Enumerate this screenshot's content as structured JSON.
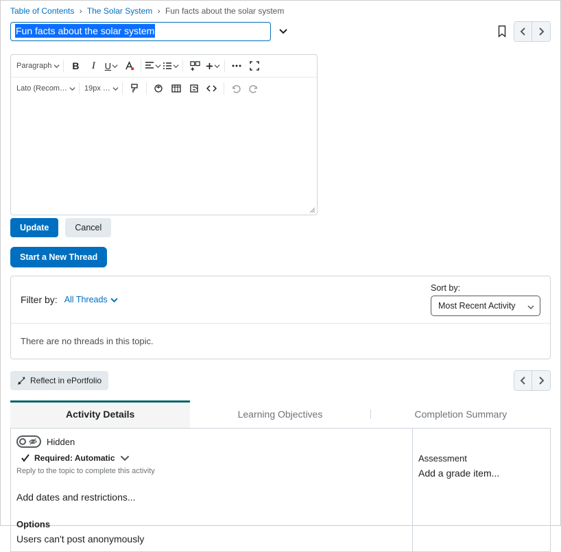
{
  "breadcrumb": {
    "root": "Table of Contents",
    "parent": "The Solar System",
    "current": "Fun facts about the solar system"
  },
  "title_value": "Fun facts about the solar system",
  "editor_toolbar": {
    "paragraph": "Paragraph",
    "font": "Lato (Recom…",
    "size": "19px …"
  },
  "buttons": {
    "update": "Update",
    "cancel": "Cancel",
    "new_thread": "Start a New Thread",
    "reflect": "Reflect in ePortfolio"
  },
  "threads": {
    "filter_label": "Filter by:",
    "filter_value": "All Threads",
    "sort_label": "Sort by:",
    "sort_value": "Most Recent Activity",
    "empty": "There are no threads in this topic."
  },
  "tabs": {
    "activity": "Activity Details",
    "objectives": "Learning Objectives",
    "completion": "Completion Summary"
  },
  "details": {
    "hidden": "Hidden",
    "required": "Required: Automatic",
    "hint": "Reply to the topic to complete this activity",
    "dates": "Add dates and restrictions...",
    "options_hdr": "Options",
    "options_text": "Users can't post anonymously"
  },
  "assessment": {
    "hdr": "Assessment",
    "link": "Add a grade item..."
  }
}
